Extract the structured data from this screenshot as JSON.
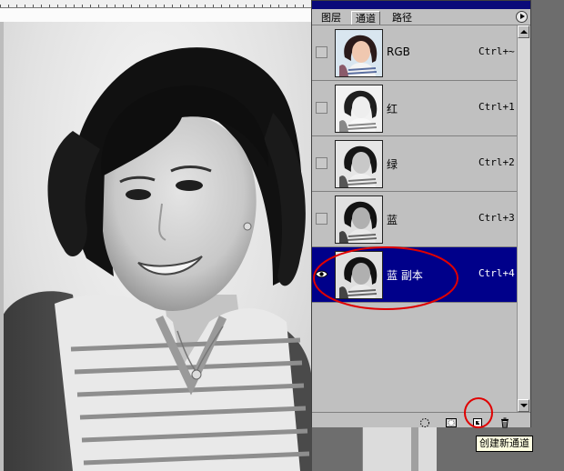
{
  "panel": {
    "tabs": [
      {
        "label": "图层",
        "active": false
      },
      {
        "label": "通道",
        "active": true
      },
      {
        "label": "路径",
        "active": false
      }
    ],
    "channels": [
      {
        "name": "RGB",
        "shortcut": "Ctrl+~",
        "visible": false,
        "selected": false,
        "thumbnail": "color-portrait"
      },
      {
        "name": "红",
        "shortcut": "Ctrl+1",
        "visible": false,
        "selected": false,
        "thumbnail": "light-grayscale-portrait"
      },
      {
        "name": "绿",
        "shortcut": "Ctrl+2",
        "visible": false,
        "selected": false,
        "thumbnail": "grayscale-portrait"
      },
      {
        "name": "蓝",
        "shortcut": "Ctrl+3",
        "visible": false,
        "selected": false,
        "thumbnail": "dark-grayscale-portrait"
      },
      {
        "name": "蓝 副本",
        "shortcut": "Ctrl+4",
        "visible": true,
        "selected": true,
        "thumbnail": "dark-grayscale-portrait"
      }
    ],
    "footer_buttons": [
      {
        "icon": "dotted-circle-icon",
        "action": "load-channel-as-selection"
      },
      {
        "icon": "save-selection-icon",
        "action": "save-selection-as-channel"
      },
      {
        "icon": "new-channel-icon",
        "action": "create-new-channel"
      },
      {
        "icon": "trash-icon",
        "action": "delete-channel"
      }
    ]
  },
  "tooltip": {
    "text": "创建新通道"
  },
  "colors": {
    "panel_bg": "#c0c0c0",
    "selection_bg": "#00008a",
    "titlebar": "#0a0a7a",
    "annotation": "#e00000",
    "tooltip_bg": "#ffffe1"
  }
}
